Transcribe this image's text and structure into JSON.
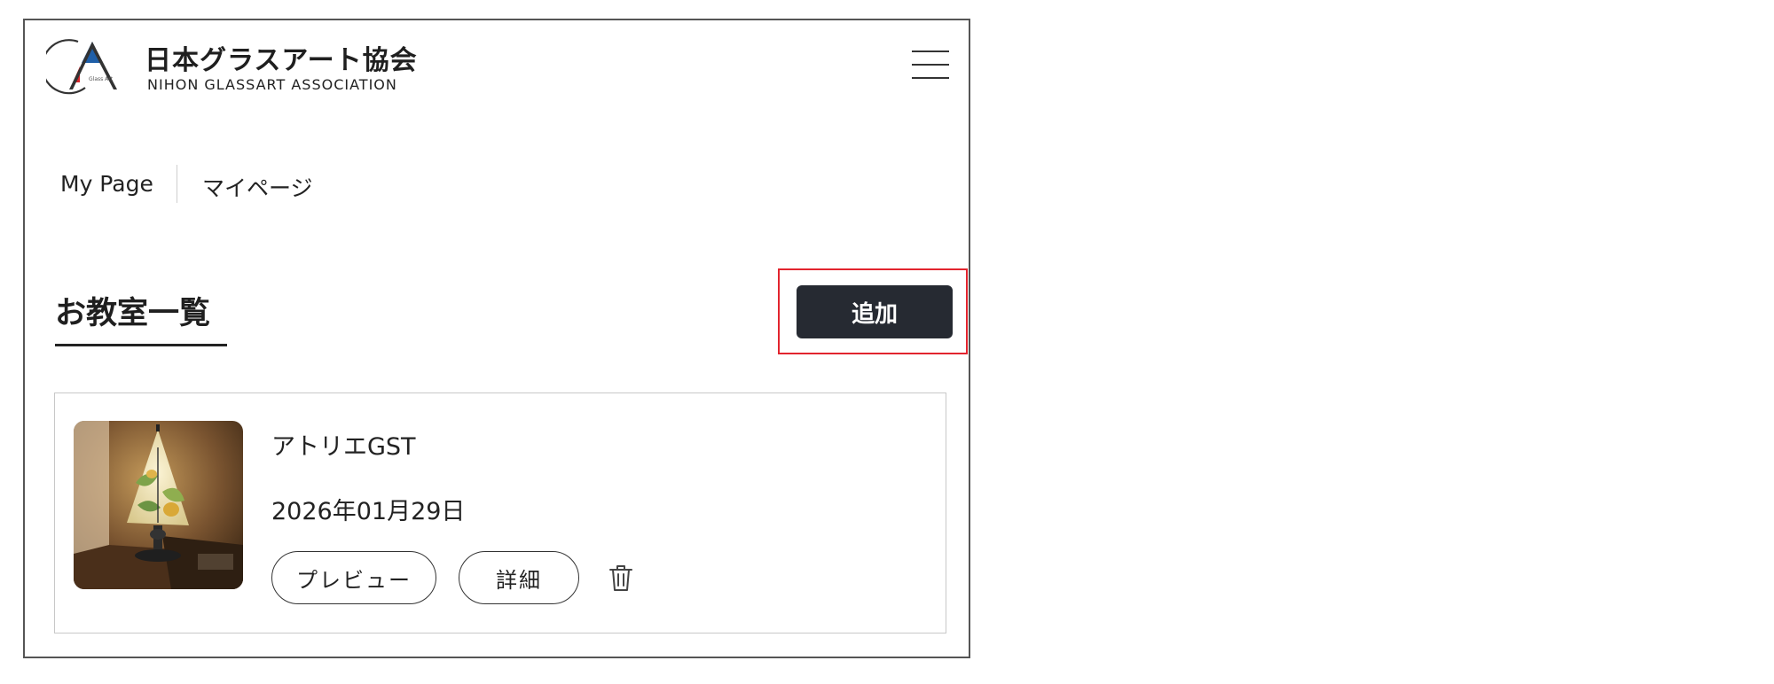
{
  "header": {
    "brand_jp": "日本グラスアート協会",
    "brand_en": "NIHON GLASSART ASSOCIATION",
    "logo_small_text": "Glass Art",
    "logo_icon": "glassart-logo-icon",
    "menu_icon": "hamburger-menu-icon"
  },
  "breadcrumb": {
    "en": "My Page",
    "jp": "マイページ"
  },
  "page": {
    "title": "お教室一覧",
    "add_label": "追加"
  },
  "classrooms": [
    {
      "name": "アトリエGST",
      "date": "2026年01月29日",
      "thumbnail_icon": "stained-glass-lamp-image",
      "preview_label": "プレビュー",
      "detail_label": "詳細",
      "delete_icon": "trash-icon"
    }
  ],
  "colors": {
    "add_button_bg": "#262a32",
    "highlight_border": "#e2242e",
    "logo_blue": "#1f5fa8",
    "logo_red": "#d8262b"
  }
}
